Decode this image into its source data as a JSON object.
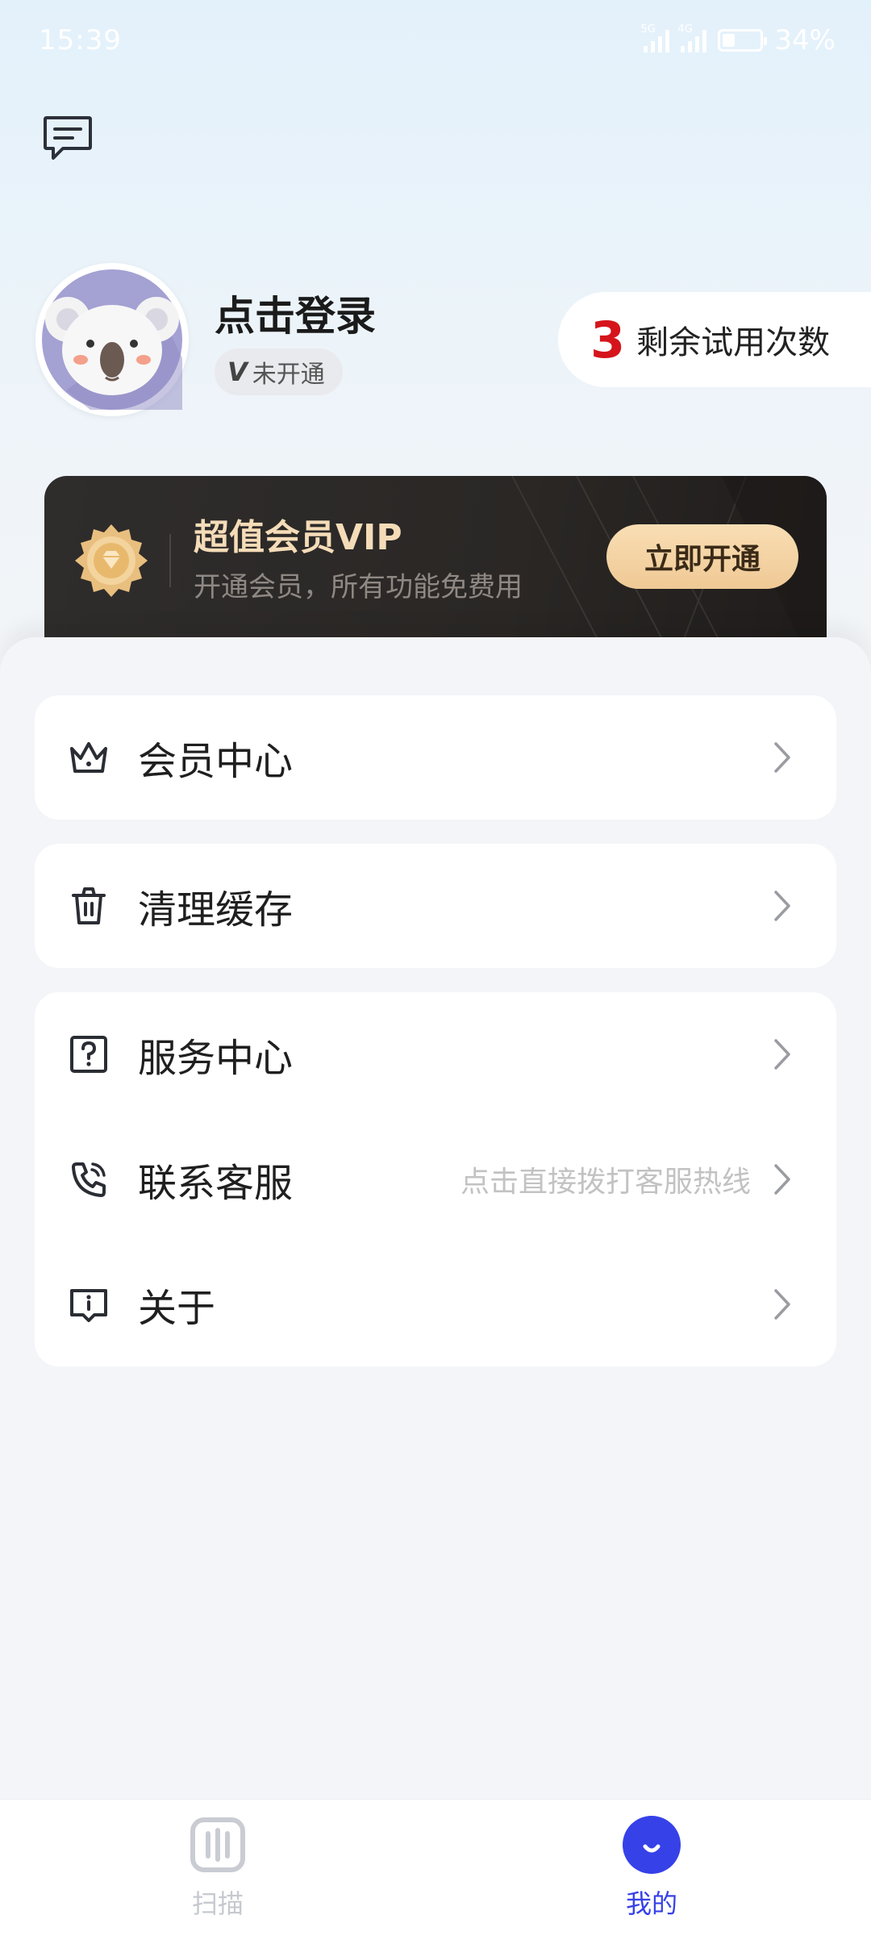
{
  "status_bar": {
    "time": "15:39",
    "signal1_tag": "5G",
    "signal2_tag": "4G",
    "battery_level": 0.34,
    "battery_text": "34%"
  },
  "header": {
    "message_icon": "message-square-icon"
  },
  "profile": {
    "avatar_icon": "koala-avatar-icon",
    "login_text": "点击登录",
    "vip_badge_mark": "V",
    "vip_badge_text": "未开通",
    "trial_count": "3",
    "trial_label": "剩余试用次数"
  },
  "vip_banner": {
    "medal_icon": "gold-medal-icon",
    "title": "超值会员VIP",
    "subtitle": "开通会员，所有功能免费用",
    "button_label": "立即开通"
  },
  "menu": {
    "member_center": {
      "icon": "crown-icon",
      "label": "会员中心"
    },
    "clear_cache": {
      "icon": "trash-icon",
      "label": "清理缓存"
    },
    "service_center": {
      "icon": "question-icon",
      "label": "服务中心"
    },
    "contact_support": {
      "icon": "phone-icon",
      "label": "联系客服",
      "hint": "点击直接拨打客服热线"
    },
    "about": {
      "icon": "info-icon",
      "label": "关于"
    }
  },
  "tabs": {
    "scan": {
      "icon": "scan-icon",
      "label": "扫描",
      "active": false
    },
    "mine": {
      "icon": "smile-icon",
      "label": "我的",
      "active": true
    }
  },
  "colors": {
    "accent": "#3641e8",
    "trial_number": "#d5151b",
    "vip_gold": "#f5dcb8",
    "vip_dark": "#2a2725"
  }
}
